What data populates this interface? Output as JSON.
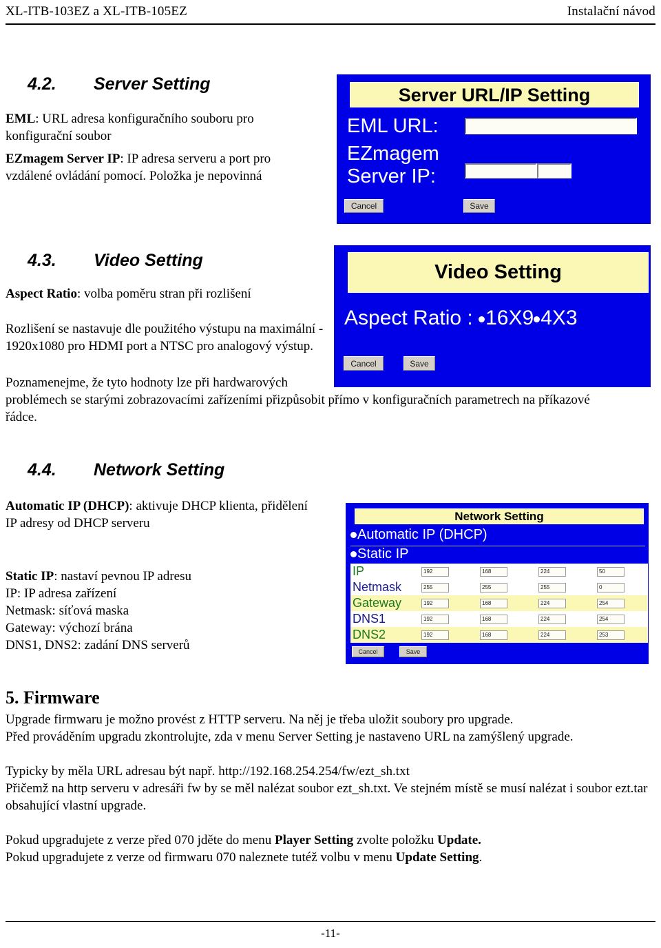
{
  "header": {
    "left": "XL-ITB-103EZ a XL-ITB-105EZ",
    "right": "Instalační návod"
  },
  "footer": {
    "page_number": "-11-"
  },
  "sections": {
    "server": {
      "number": "4.2.",
      "title": "Server Setting",
      "para1_bold": "EML",
      "para1_rest": ": URL adresa konfiguračního souboru pro konfigurační soubor",
      "para2_bold": "EZmagem Server IP",
      "para2_rest": ": IP adresa serveru a port pro vzdálené ovládání pomocí. Položka je nepovinná"
    },
    "video": {
      "number": "4.3.",
      "title": "Video Setting",
      "para1_bold": "Aspect Ratio",
      "para1_rest": ": volba poměru stran při rozlišení",
      "para2": "Rozlišení se nastavuje dle použitého výstupu na maximální - 1920x1080 pro HDMI port a NTSC pro analogový výstup.",
      "para3_a": "Poznamenejme, že tyto hodnoty lze při hardwarových",
      "para3_b": "problémech se starými zobrazovacími zařízeními přizpůsobit přímo v konfiguračních parametrech na příkazové řádce."
    },
    "network": {
      "number": "4.4.",
      "title": "Network Setting",
      "para1_bold": "Automatic IP (DHCP)",
      "para1_rest": ": aktivuje DHCP klienta, přidělení IP adresy od DHCP serveru",
      "para2_bold": "Static IP",
      "para2_rest": ": nastaví pevnou IP adresu",
      "line_ip": "IP: IP adresa zařízení",
      "line_netmask": "Netmask: síťová maska",
      "line_gateway": "Gateway: výchozí brána",
      "line_dns": "DNS1, DNS2: zadání DNS serverů"
    },
    "firmware": {
      "heading": "5. Firmware",
      "p1": "Upgrade firmwaru je možno provést z HTTP serveru. Na něj je třeba uložit soubory pro upgrade.",
      "p2": "Před prováděním upgradu zkontrolujte, zda v menu Server Setting je nastaveno URL na zamýšlený upgrade.",
      "p3": "Typicky by měla URL adresau být např.  http://192.168.254.254/fw/ezt_sh.txt",
      "p4": "Přičemž na http serveru v adresáři fw by se měl nalézat soubor ezt_sh.txt. Ve stejném místě se musí nalézat i soubor ezt.tar obsahující vlastní upgrade.",
      "p5_pre": "Pokud upgradujete z verze před 070 jděte do menu ",
      "p5_b1": "Player Setting",
      "p5_mid": " zvolte položku ",
      "p5_b2": "Update.",
      "p6_pre": "Pokud upgradujete z verze od firmwaru  070 naleznete tutéž volbu v menu ",
      "p6_b1": "Update Setting",
      "p6_post": "."
    }
  },
  "dialogs": {
    "server": {
      "title": "Server URL/IP Setting",
      "label_eml": "EML URL:",
      "label_ez_line1": "EZmagem",
      "label_ez_line2": "Server IP:",
      "value_eml": "",
      "value_ip": "",
      "value_port": "",
      "cancel": "Cancel",
      "save": "Save"
    },
    "video": {
      "title": "Video Setting",
      "label_aspect": "Aspect Ratio :",
      "option_16x9": "16X9",
      "option_4x3": "4X3",
      "cancel": "Cancel",
      "save": "Save"
    },
    "network": {
      "title": "Network Setting",
      "option_dhcp": "Automatic IP (DHCP)",
      "option_static": "Static IP",
      "rows": [
        {
          "name": "IP",
          "color": "#1f7a1f",
          "octets": [
            "192",
            "168",
            "224",
            "50"
          ]
        },
        {
          "name": "Netmask",
          "color": "#1c1c8c",
          "octets": [
            "255",
            "255",
            "255",
            "0"
          ]
        },
        {
          "name": "Gateway",
          "color": "#1f7a1f",
          "octets": [
            "192",
            "168",
            "224",
            "254"
          ]
        },
        {
          "name": "DNS1",
          "color": "#1c1c8c",
          "octets": [
            "192",
            "168",
            "224",
            "254"
          ]
        },
        {
          "name": "DNS2",
          "color": "#1f7a1f",
          "octets": [
            "192",
            "168",
            "224",
            "253"
          ]
        }
      ],
      "cancel": "Cancel",
      "save": "Save"
    }
  },
  "colors": {
    "dialog_background": "#0000e6",
    "dialog_title_background": "#fbf8b6",
    "row_alt_background": "#fbf8b6",
    "button_face": "#d4d0c8"
  }
}
